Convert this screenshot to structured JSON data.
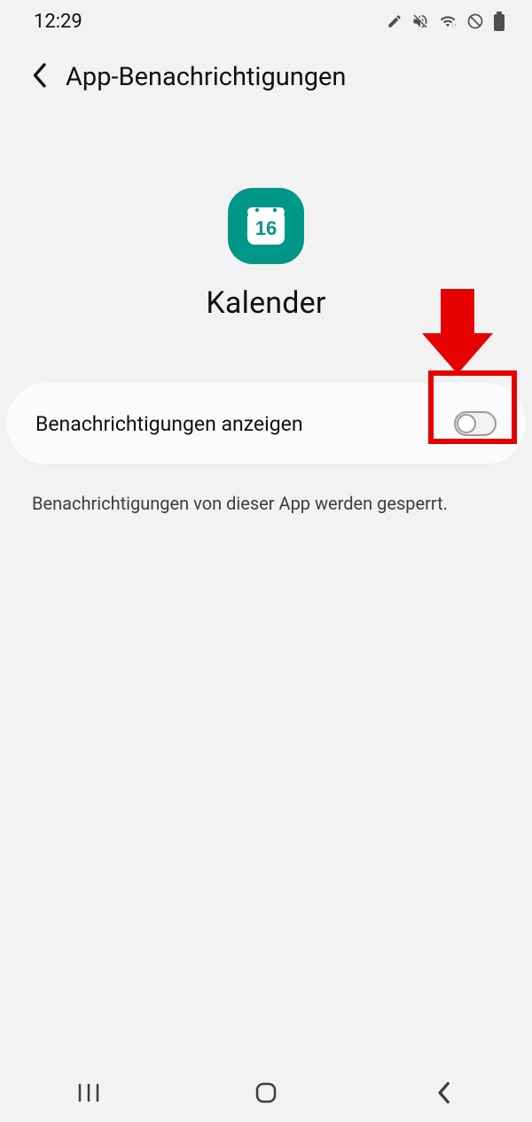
{
  "status": {
    "time": "12:29"
  },
  "header": {
    "title": "App-Benachrichtigungen"
  },
  "app": {
    "name": "Kalender",
    "icon_day": "16"
  },
  "setting": {
    "label": "Benachrichtigungen anzeigen",
    "enabled": false
  },
  "blocked_text": "Benachrichtigungen von dieser App werden gesperrt."
}
